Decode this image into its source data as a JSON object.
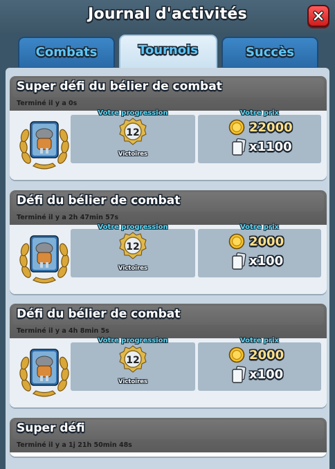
{
  "header": {
    "title": "Journal d'activités"
  },
  "tabs": [
    {
      "label": "Combats",
      "active": false
    },
    {
      "label": "Tournois",
      "active": true
    },
    {
      "label": "Succès",
      "active": false
    }
  ],
  "labels": {
    "progression": "Votre progression",
    "prize": "Votre prix",
    "wins": "Victoires"
  },
  "entries": [
    {
      "title": "Super défi du bélier de combat",
      "time": "Terminé il y a 0s",
      "wins": "12",
      "gold": "22000",
      "cards": "x1100"
    },
    {
      "title": "Défi du bélier de combat",
      "time": "Terminé il y a 2h 47min  57s",
      "wins": "12",
      "gold": "2000",
      "cards": "x100"
    },
    {
      "title": "Défi du bélier de combat",
      "time": "Terminé il y a 4h 8min  5s",
      "wins": "12",
      "gold": "2000",
      "cards": "x100"
    },
    {
      "title": "Super défi",
      "time": "Terminé il y a 1j 21h 50min  48s"
    }
  ],
  "colors": {
    "tab_blue": "#3c87c8",
    "tab_active": "#e4f1fa",
    "close_red": "#e02a2a",
    "progress_label": "#5ad8f4",
    "gold_text": "#ffe08a"
  },
  "icons": [
    "close-icon",
    "trophy-badge-icon",
    "wins-shield-icon",
    "gold-coin-icon",
    "card-stack-icon"
  ]
}
